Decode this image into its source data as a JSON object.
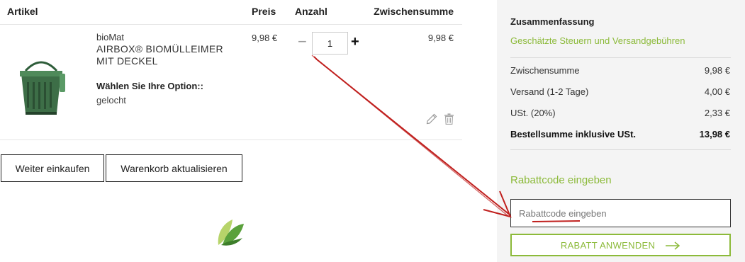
{
  "cart": {
    "headers": {
      "artikel": "Artikel",
      "preis": "Preis",
      "anzahl": "Anzahl",
      "zwischensumme": "Zwischensumme"
    },
    "item": {
      "brand": "bioMat",
      "name": "AIRBOX® BIOMÜLLEIMER MIT DECKEL",
      "option_label": "Wählen Sie Ihre Option::",
      "option_value": "gelocht",
      "price": "9,98 €",
      "qty_minus": "−",
      "quantity": "1",
      "qty_plus": "+",
      "subtotal": "9,98 €"
    },
    "buttons": {
      "continue_shopping": "Weiter einkaufen",
      "update_cart": "Warenkorb aktualisieren"
    }
  },
  "summary": {
    "title": "Zusammenfassung",
    "estimate_link": "Geschätzte Steuern und Versandgebühren",
    "rows": [
      {
        "label": "Zwischensumme",
        "value": "9,98 €"
      },
      {
        "label": "Versand (1-2 Tage)",
        "value": "4,00 €"
      },
      {
        "label": "USt. (20%)",
        "value": "2,33 €"
      },
      {
        "label": "Bestellsumme inklusive USt.",
        "value": "13,98 €"
      }
    ],
    "discount": {
      "title": "Rabattcode eingeben",
      "placeholder": "Rabattcode eingeben",
      "apply_label": "RABATT ANWENDEN"
    }
  },
  "colors": {
    "accent_green": "#8cba3a",
    "annotation_red": "#c0201e",
    "panel_bg": "#f4f4f4"
  }
}
